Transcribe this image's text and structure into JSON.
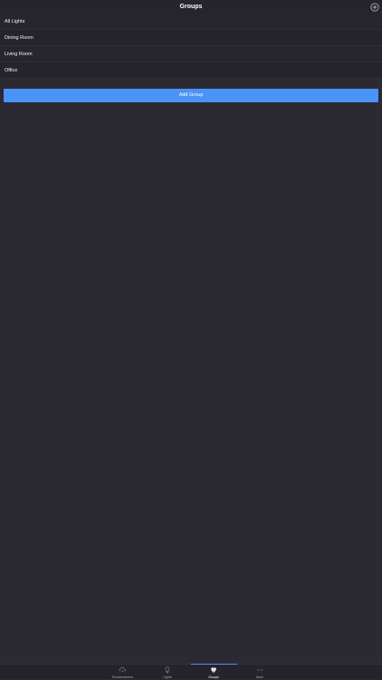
{
  "header": {
    "title": "Groups",
    "add_icon": "plus-circle-icon"
  },
  "groups": [
    {
      "label": "All Lights"
    },
    {
      "label": "Dining Room"
    },
    {
      "label": "Living Room"
    },
    {
      "label": "Office"
    }
  ],
  "add_group_button": {
    "label": "Add Group"
  },
  "tabbar": {
    "tabs": [
      {
        "label": "Thunderstorms",
        "icon": "cloud-lightning-icon",
        "active": false
      },
      {
        "label": "Lights",
        "icon": "bulb-icon",
        "active": false
      },
      {
        "label": "Groups",
        "icon": "groups-icon",
        "active": true
      },
      {
        "label": "More",
        "icon": "more-dots-icon",
        "active": false
      }
    ]
  },
  "colors": {
    "background": "#2b2a33",
    "accent": "#4a93f8"
  }
}
